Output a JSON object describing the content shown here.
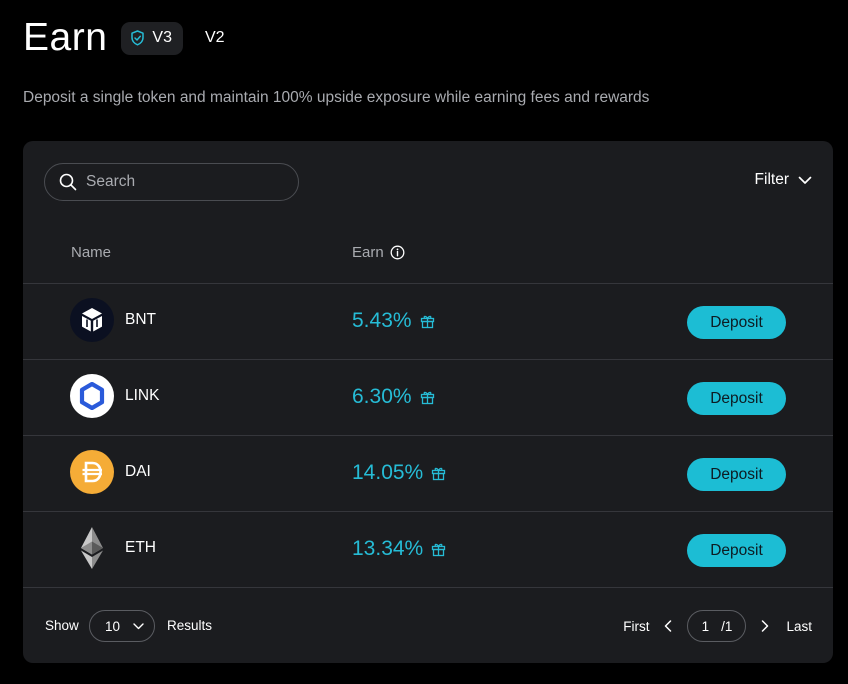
{
  "header": {
    "title": "Earn",
    "version_active": "V3",
    "version_inactive": "V2",
    "subtitle": "Deposit a single token and maintain 100% upside exposure while earning fees and rewards"
  },
  "search": {
    "placeholder": "Search"
  },
  "filter": {
    "label": "Filter"
  },
  "table": {
    "columns": {
      "name": "Name",
      "earn": "Earn"
    },
    "rows": [
      {
        "name": "BNT",
        "earn": "5.43%",
        "action": "Deposit",
        "icon": "bnt-icon"
      },
      {
        "name": "LINK",
        "earn": "6.30%",
        "action": "Deposit",
        "icon": "link-icon"
      },
      {
        "name": "DAI",
        "earn": "14.05%",
        "action": "Deposit",
        "icon": "dai-icon"
      },
      {
        "name": "ETH",
        "earn": "13.34%",
        "action": "Deposit",
        "icon": "eth-icon"
      }
    ]
  },
  "footer": {
    "show_label": "Show",
    "page_size": "10",
    "results_label": "Results",
    "first_label": "First",
    "current_page": "1",
    "total_pages": "/1",
    "last_label": "Last"
  },
  "colors": {
    "background": "#000000",
    "panel": "#1b1c1f",
    "accent": "#1cbdd4",
    "earn_text": "#26bcd6",
    "muted_text": "#a9abb0"
  }
}
